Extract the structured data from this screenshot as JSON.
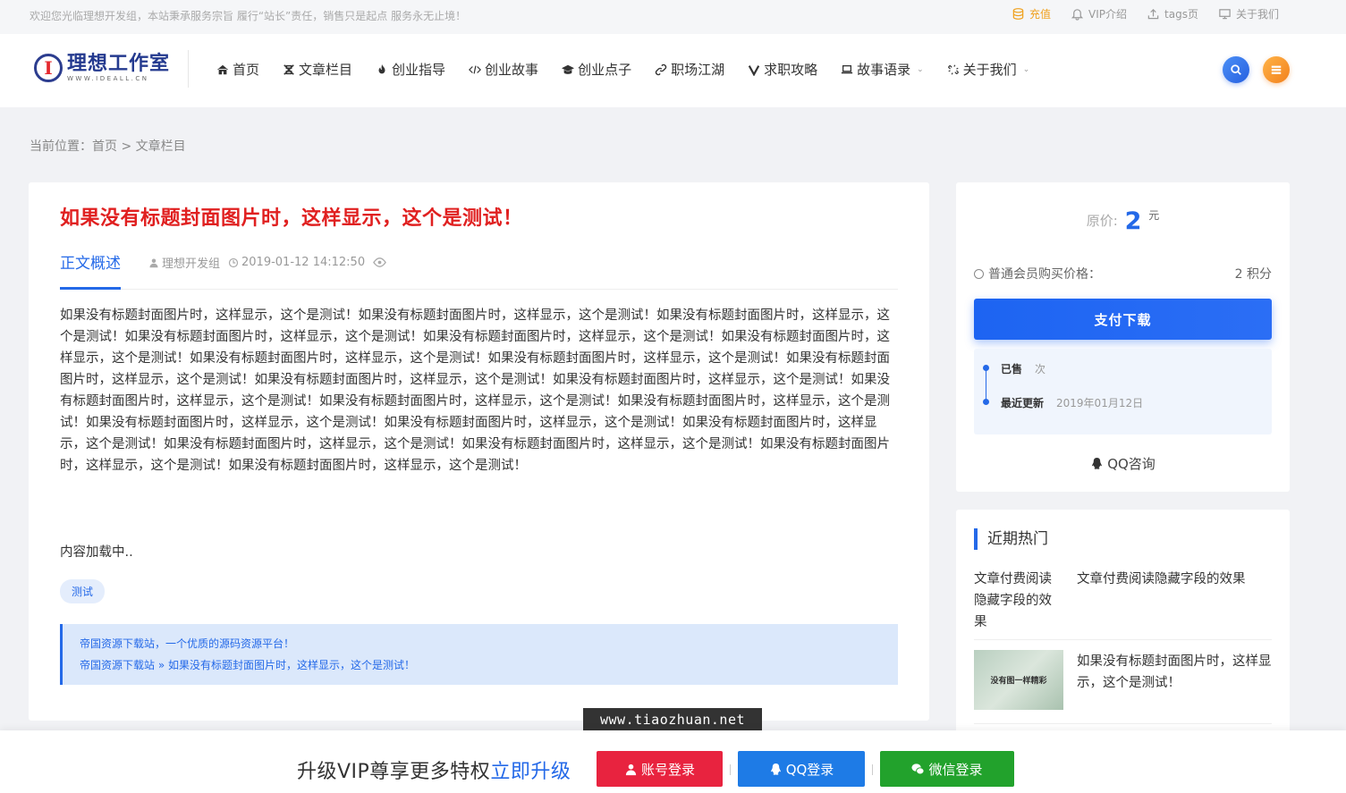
{
  "topbar": {
    "welcome": "欢迎您光临理想开发组，本站秉承服务宗旨 履行“站长”责任，销售只是起点 服务永无止境！",
    "links": [
      "充值",
      "VIP介绍",
      "tags页",
      "关于我们"
    ],
    "accent": "#f0a11d"
  },
  "header": {
    "logo_title": "理想工作室",
    "logo_sub": "WWW.IDEALL.CN",
    "nav": [
      "首页",
      "文章栏目",
      "创业指导",
      "创业故事",
      "创业点子",
      "职场江湖",
      "求职攻略",
      "故事语录",
      "关于我们"
    ]
  },
  "breadcrumb": "当前位置：首页 > 文章栏目",
  "article": {
    "title": "如果没有标题封面图片时，这样显示，这个是测试！",
    "tab": "正文概述",
    "author": "理想开发组",
    "datetime": "2019-01-12 14:12:50",
    "body": "如果没有标题封面图片时，这样显示，这个是测试！如果没有标题封面图片时，这样显示，这个是测试！如果没有标题封面图片时，这样显示，这个是测试！如果没有标题封面图片时，这样显示，这个是测试！如果没有标题封面图片时，这样显示，这个是测试！如果没有标题封面图片时，这样显示，这个是测试！如果没有标题封面图片时，这样显示，这个是测试！如果没有标题封面图片时，这样显示，这个是测试！如果没有标题封面图片时，这样显示，这个是测试！如果没有标题封面图片时，这样显示，这个是测试！如果没有标题封面图片时，这样显示，这个是测试！如果没有标题封面图片时，这样显示，这个是测试！如果没有标题封面图片时，这样显示，这个是测试！如果没有标题封面图片时，这样显示，这个是测试！如果没有标题封面图片时，这样显示，这个是测试！如果没有标题封面图片时，这样显示，这个是测试！如果没有标题封面图片时，这样显示，这个是测试！如果没有标题封面图片时，这样显示，这个是测试！如果没有标题封面图片时，这样显示，这个是测试！如果没有标题封面图片时，这样显示，这个是测试！如果没有标题封面图片时，这样显示，这个是测试！",
    "loading": "内容加载中..",
    "tag": "测试",
    "notice_line1": "帝国资源下载站，一个优质的源码资源平台！",
    "notice_line2": "帝国资源下载站 » 如果没有标题封面图片时，这样显示，这个是测试！"
  },
  "buy": {
    "price_label": "原价:",
    "price_value": "2",
    "price_unit": "元",
    "member_label": "普通会员购买价格：",
    "member_value": "2 积分",
    "pay_button": "支付下载",
    "sold_label": "已售",
    "sold_value": "次",
    "update_label": "最近更新",
    "update_value": "2019年01月12日",
    "qq_consult": "QQ咨询"
  },
  "hot": {
    "title": "近期热门",
    "items": [
      {
        "image_alt": "文章付费阅读隐藏字段的效果",
        "text": "文章付费阅读隐藏字段的效果"
      },
      {
        "image_text": "没有图一样精彩",
        "text": "如果没有标题封面图片时，这样显示，这个是测试！"
      }
    ]
  },
  "watermark": "www.tiaozhuan.net",
  "bottombar": {
    "vip_text": "升级VIP尊享更多特权",
    "vip_link": "立即升级",
    "account_login": "账号登录",
    "qq_login": "QQ登录",
    "wechat_login": "微信登录"
  }
}
